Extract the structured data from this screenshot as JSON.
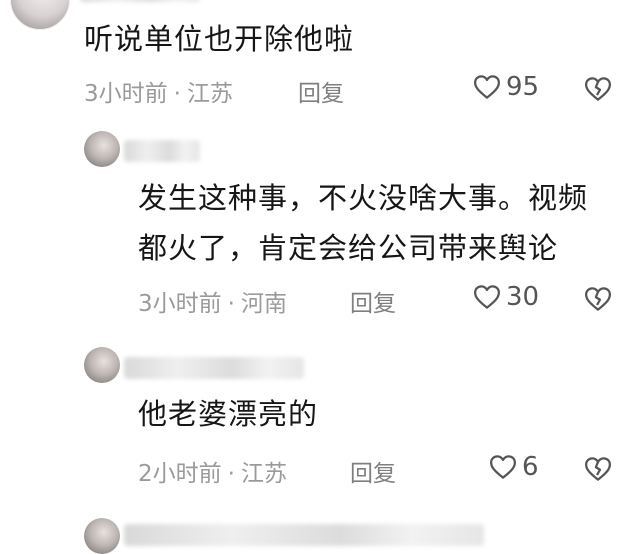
{
  "comments": [
    {
      "text": "听说单位也开除他啦",
      "time": "3小时前",
      "separator": "·",
      "location": "江苏",
      "reply_label": "回复",
      "likes": "95"
    },
    {
      "text_line1": "发生这种事，不火没啥大事。视频",
      "text_line2": "都火了，肯定会给公司带来舆论",
      "time": "3小时前",
      "separator": "·",
      "location": "河南",
      "reply_label": "回复",
      "likes": "30"
    },
    {
      "text": "他老婆漂亮的",
      "time": "2小时前",
      "separator": "·",
      "location": "江苏",
      "reply_label": "回复",
      "likes": "6"
    }
  ],
  "icons": {
    "like": "heart-outline-icon",
    "dislike": "broken-heart-icon"
  },
  "colors": {
    "meta_text": "#9a9a9a",
    "body_text": "#161616",
    "icon_stroke": "#555555"
  }
}
